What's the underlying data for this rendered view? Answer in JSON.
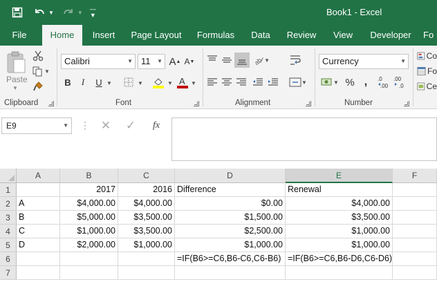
{
  "window": {
    "title": "Book1 - Excel"
  },
  "colors": {
    "brand": "#217346",
    "ribbon_bg": "#f3f3f3",
    "font_color_underline": "#c00000",
    "highlight_yellow": "#ffff00"
  },
  "quick_access": {
    "icons": [
      "save-icon",
      "undo-icon",
      "redo-icon",
      "customize-qat-icon"
    ]
  },
  "tabs": [
    "File",
    "Home",
    "Insert",
    "Page Layout",
    "Formulas",
    "Data",
    "Review",
    "View",
    "Developer",
    "Fo"
  ],
  "ribbon": {
    "clipboard": {
      "paste_label": "Paste",
      "group_label": "Clipboard"
    },
    "font": {
      "font_name": "Calibri",
      "font_size": "11",
      "group_label": "Font",
      "bold": "B",
      "italic": "I",
      "underline": "U"
    },
    "alignment": {
      "group_label": "Alignment"
    },
    "number": {
      "format": "Currency",
      "group_label": "Number",
      "percent": "%"
    },
    "styles": {
      "items": [
        "Co",
        "Fo",
        "Ce"
      ]
    }
  },
  "formula_bar": {
    "name_box": "E9",
    "fx_label": "fx",
    "content": ""
  },
  "sheet": {
    "columns": [
      "A",
      "B",
      "C",
      "D",
      "E",
      "F"
    ],
    "selected_column": "E",
    "rows": [
      {
        "num": "1",
        "A": "",
        "B": "2017",
        "C": "2016",
        "D": "Difference",
        "E": "Renewal"
      },
      {
        "num": "2",
        "A": "A",
        "B": "$4,000.00",
        "C": "$4,000.00",
        "D": "$0.00",
        "E": "$4,000.00"
      },
      {
        "num": "3",
        "A": "B",
        "B": "$5,000.00",
        "C": "$3,500.00",
        "D": "$1,500.00",
        "E": "$3,500.00"
      },
      {
        "num": "4",
        "A": "C",
        "B": "$1,000.00",
        "C": "$3,500.00",
        "D": "$2,500.00",
        "E": "$1,000.00"
      },
      {
        "num": "5",
        "A": "D",
        "B": "$2,000.00",
        "C": "$1,000.00",
        "D": "$1,000.00",
        "E": "$1,000.00"
      },
      {
        "num": "6",
        "A": "",
        "B": "",
        "C": "",
        "D": "=IF(B6>=C6,B6-C6,C6-B6)",
        "E": "=IF(B6>=C6,B6-D6,C6-D6)"
      },
      {
        "num": "7",
        "A": "",
        "B": "",
        "C": "",
        "D": "",
        "E": ""
      }
    ]
  }
}
